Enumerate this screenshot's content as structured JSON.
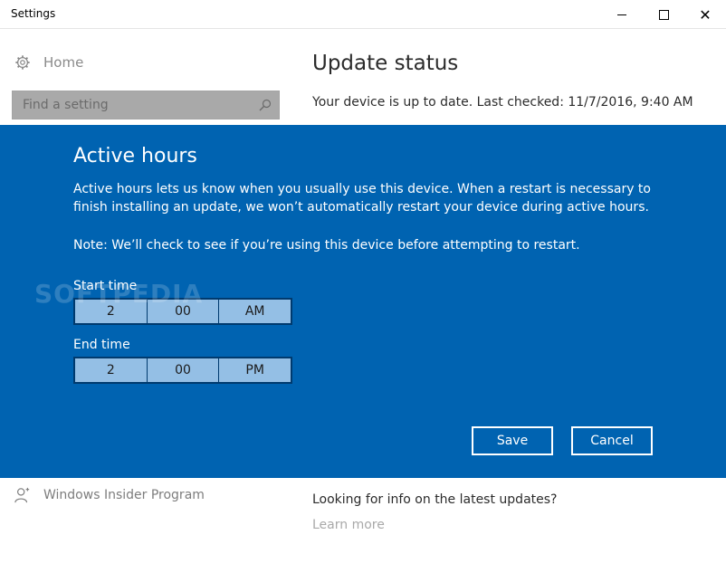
{
  "window": {
    "title": "Settings"
  },
  "sidebar": {
    "home_label": "Home",
    "search_placeholder": "Find a setting",
    "insider_label": "Windows Insider Program"
  },
  "main": {
    "heading": "Update status",
    "status_text": "Your device is up to date. Last checked: 11/7/2016, 9:40 AM",
    "info_text": "Looking for info on the latest updates?",
    "learn_more": "Learn more"
  },
  "dialog": {
    "title": "Active hours",
    "description": "Active hours lets us know when you usually use this device. When a restart is necessary to finish installing an update, we won’t automatically restart your device during active hours.",
    "note": "Note: We’ll check to see if you’re using this device before attempting to restart.",
    "start_label": "Start time",
    "start": {
      "hour": "2",
      "minute": "00",
      "period": "AM"
    },
    "end_label": "End time",
    "end": {
      "hour": "2",
      "minute": "00",
      "period": "PM"
    },
    "save_label": "Save",
    "cancel_label": "Cancel"
  },
  "watermark": "SOFTPEDIA",
  "colors": {
    "accent": "#0063b1",
    "picker": "#94bfe5"
  }
}
